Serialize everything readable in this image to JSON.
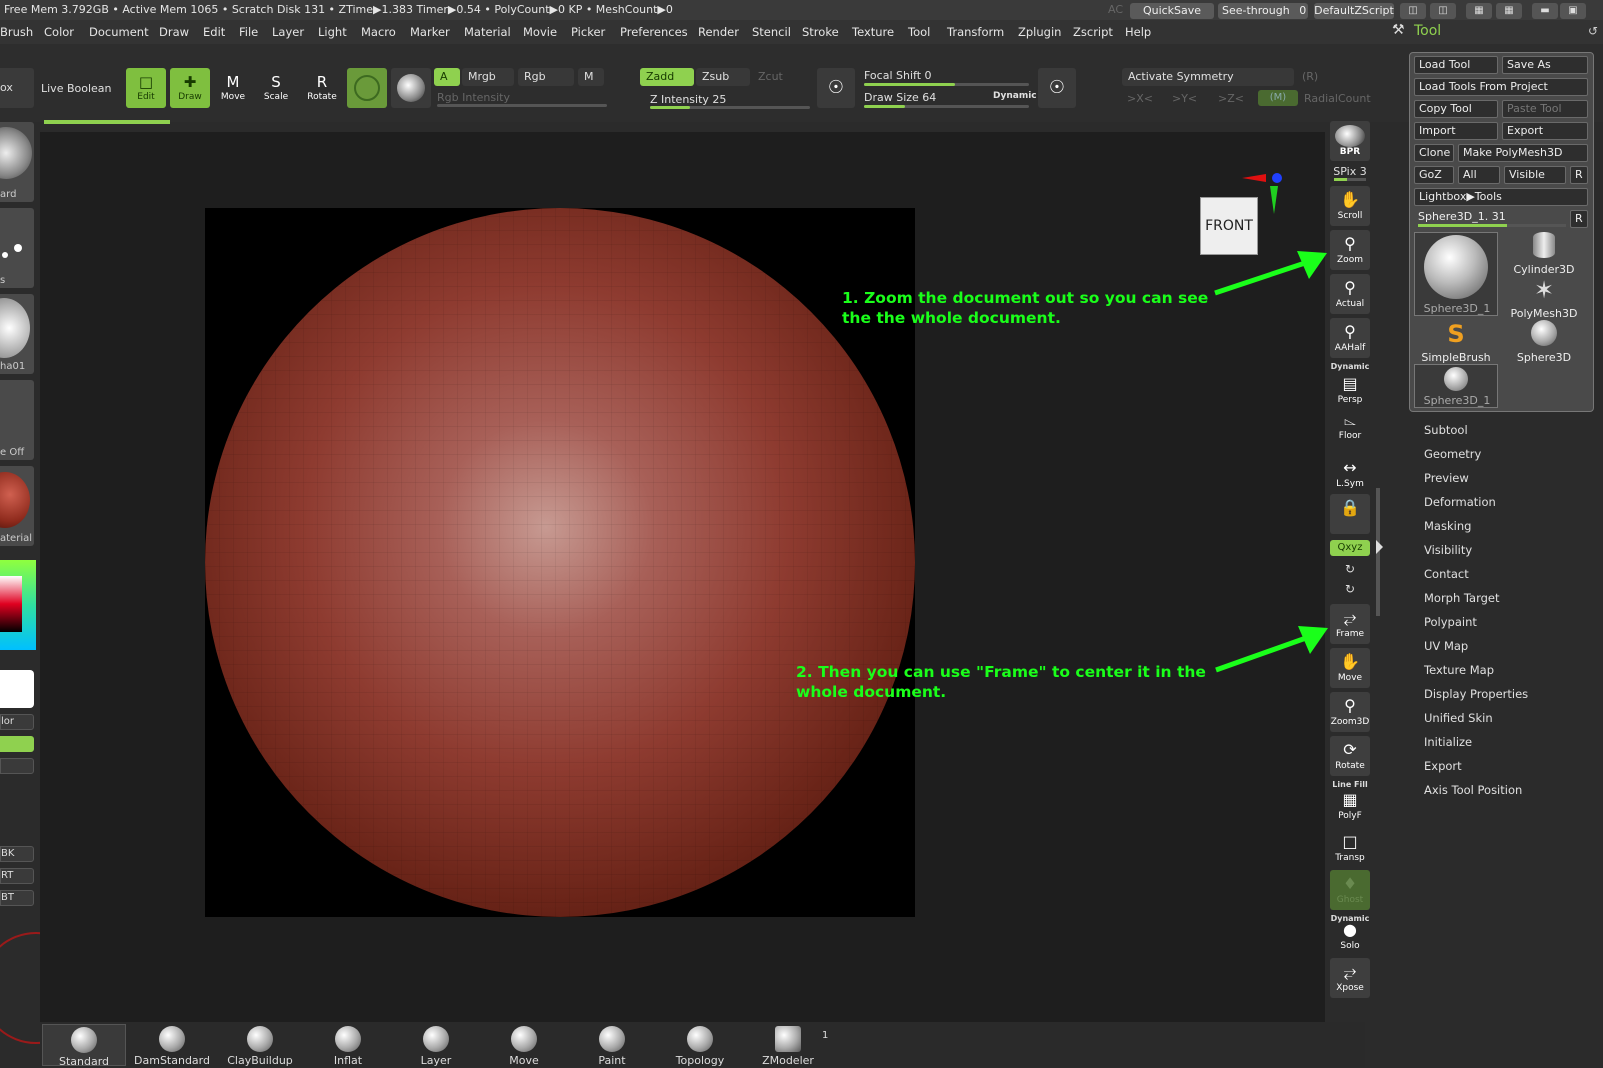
{
  "status": {
    "text": "Free Mem 3.792GB • Active Mem 1065 • Scratch Disk 131 • ZTime▶1.383 Timer▶0.54 • PolyCount▶0 KP • MeshCount▶0",
    "ac": "AC",
    "quicksave": "QuickSave",
    "seethrough": "See-through",
    "seethrough_value": "0",
    "zscript": "DefaultZScript"
  },
  "menu": [
    "Brush",
    "Color",
    "Document",
    "Draw",
    "Edit",
    "File",
    "Layer",
    "Light",
    "Macro",
    "Marker",
    "Material",
    "Movie",
    "Picker",
    "Preferences",
    "Render",
    "Stencil",
    "Stroke",
    "Texture",
    "Tool",
    "Transform",
    "Zplugin",
    "Zscript",
    "Help"
  ],
  "tool_tab": "Tool",
  "toolbar": {
    "lightbox_cut": "ox",
    "live_boolean": "Live Boolean",
    "edit": "Edit",
    "draw": "Draw",
    "move": "Move",
    "scale": "Scale",
    "rotate": "Rotate",
    "a": "A",
    "mrgb": "Mrgb",
    "rgb": "Rgb",
    "m": "M",
    "rgb_intensity": "Rgb Intensity",
    "zadd": "Zadd",
    "zsub": "Zsub",
    "zcut": "Zcut",
    "z_intensity": "Z Intensity 25",
    "focal_shift": "Focal Shift 0",
    "draw_size": "Draw Size 64",
    "dynamic": "Dynamic",
    "activate_symmetry": "Activate Symmetry",
    "r": "(R)",
    "x": ">X<",
    "y": ">Y<",
    "z": ">Z<",
    "mm": "(M)",
    "radial_count": "RadialCount"
  },
  "left_shelf": {
    "labels": [
      "ard",
      "s",
      "ha01",
      "e Off",
      "aterial"
    ],
    "buttons": [
      "lor",
      "",
      "",
      "BK",
      "RT",
      "BT"
    ]
  },
  "annotations": {
    "a1_line1": "1. Zoom the document out so you can see",
    "a1_line2": "the the whole document.",
    "a2_line1": "2. Then you can use \"Frame\" to center it in the",
    "a2_line2": "whole document."
  },
  "front_label": "FRONT",
  "right_shelf": {
    "bpr": "BPR",
    "spix": "SPix 3",
    "scroll": "Scroll",
    "zoom": "Zoom",
    "actual": "Actual",
    "aahalf": "AAHalf",
    "dynamic": "Dynamic",
    "persp": "Persp",
    "floor": "Floor",
    "lsym": "L.Sym",
    "xyz": "Qxyz",
    "frame": "Frame",
    "move": "Move",
    "zoom3d": "Zoom3D",
    "rotate": "Rotate",
    "linefill": "Line Fill",
    "polyf": "PolyF",
    "transp": "Transp",
    "ghost": "Ghost",
    "dynamic2": "Dynamic",
    "solo": "Solo",
    "xpose": "Xpose"
  },
  "tool_panel": {
    "load_tool": "Load Tool",
    "save_as": "Save As",
    "load_from_project": "Load Tools From Project",
    "copy_tool": "Copy Tool",
    "paste_tool": "Paste Tool",
    "import": "Import",
    "export": "Export",
    "clone": "Clone",
    "make_polymesh": "Make PolyMesh3D",
    "goz": "GoZ",
    "all": "All",
    "visible": "Visible",
    "r": "R",
    "lightbox_tools": "Lightbox▶Tools",
    "current_tool": "Sphere3D_1. 31",
    "r2": "R",
    "tools": [
      "Sphere3D_1",
      "Cylinder3D",
      "PolyMesh3D",
      "SimpleBrush",
      "Sphere3D",
      "Sphere3D_1"
    ]
  },
  "tool_sections": [
    "Subtool",
    "Geometry",
    "Preview",
    "Deformation",
    "Masking",
    "Visibility",
    "Contact",
    "Morph Target",
    "Polypaint",
    "UV Map",
    "Texture Map",
    "Display Properties",
    "Unified Skin",
    "Initialize",
    "Export",
    "Axis Tool Position"
  ],
  "brushes": [
    "Standard",
    "DamStandard",
    "ClayBuildup",
    "Inflat",
    "Layer",
    "Move",
    "Paint",
    "Topology",
    "ZModeler"
  ],
  "brush_count": "1"
}
